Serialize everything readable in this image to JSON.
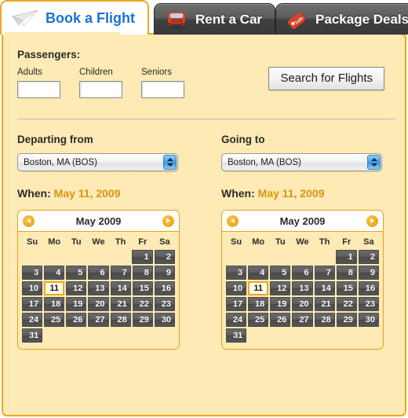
{
  "tabs": [
    {
      "label": "Book a Flight",
      "icon": "paper-plane-icon",
      "active": true
    },
    {
      "label": "Rent a Car",
      "icon": "car-icon",
      "active": false
    },
    {
      "label": "Package Deals",
      "icon": "sale-tag-icon",
      "active": false
    }
  ],
  "passengers": {
    "title": "Passengers:",
    "fields": [
      {
        "label": "Adults",
        "value": "",
        "name": "adults-input"
      },
      {
        "label": "Children",
        "value": "",
        "name": "children-input"
      },
      {
        "label": "Seniors",
        "value": "",
        "name": "seniors-input"
      }
    ]
  },
  "search_button": "Search for Flights",
  "departing": {
    "title": "Departing from",
    "selected": "Boston, MA (BOS)",
    "when_label": "When:",
    "when_date": "May 11, 2009"
  },
  "arriving": {
    "title": "Going to",
    "selected": "Boston, MA (BOS)",
    "when_label": "When:",
    "when_date": "May 11, 2009"
  },
  "calendar": {
    "month_title": "May 2009",
    "dow": [
      "Su",
      "Mo",
      "Tu",
      "We",
      "Th",
      "Fr",
      "Sa"
    ],
    "lead_blanks": 5,
    "days_in_month": 31,
    "selected_day": 11,
    "prev_label": "Previous month",
    "next_label": "Next month"
  },
  "colors": {
    "accent_orange": "#eda71c",
    "panel_bg": "#fdeab4",
    "link_blue": "#1a72d0",
    "date_text": "#d99412",
    "day_cell": "#555555",
    "tab_inactive": "#3f3f3f"
  }
}
